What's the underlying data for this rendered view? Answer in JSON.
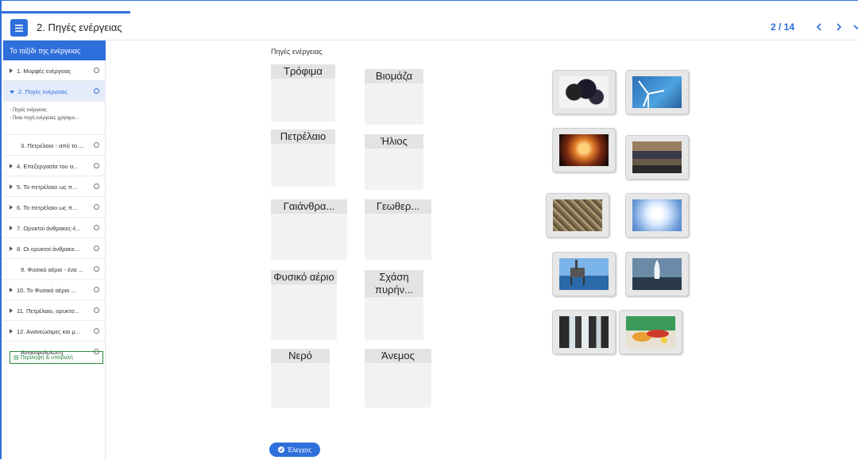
{
  "header": {
    "title": "2. Πηγές ενέργειας",
    "page_count": "2 / 14"
  },
  "icons": {
    "menu": "hamburger-icon",
    "prev": "chevron-left-icon",
    "next": "chevron-right-icon",
    "expand": "chevron-down-icon",
    "check": "check-circle-icon",
    "submit": "document-icon"
  },
  "colors": {
    "accent": "#2f6fdc",
    "submit": "#2a8a3e",
    "dropzone": "#f2f2f2"
  },
  "sidebar": {
    "heading": "Το ταξίδι της ενέργειας",
    "items": [
      {
        "label": "1. Μορφές ενέργειας"
      },
      {
        "label": "2. Πηγές ενέργειας"
      },
      {
        "label": "3. Πετρέλαιο - από το ..."
      },
      {
        "label": "4. Επεξεργασία του α..."
      },
      {
        "label": "5. Το πετρέλαιο ως π..."
      },
      {
        "label": "6. Το πετρέλαιο ως π..."
      },
      {
        "label": "7. Ορυκτοί άνθρακες-έ..."
      },
      {
        "label": "8. Οι ορυκτοί άνθρακε..."
      },
      {
        "label": "9. Φυσικό αέριο - ένα ..."
      },
      {
        "label": "10. Το Φυσικό αέριο ..."
      },
      {
        "label": "11. Πετρέλαιο, ορυκτο..."
      },
      {
        "label": "12. Ανανεώσιμες και μ..."
      },
      {
        "label": "Ανακεφαλαίωση"
      }
    ],
    "subitems": [
      "Πηγές ενέργειας",
      "Ποια πηγή ενέργειας χρησιμο..."
    ],
    "submit_label": "Περίληψη & υποβολή"
  },
  "exercise": {
    "title": "Πηγές ενέργειας",
    "dropzones": [
      "Τρόφιμα",
      "Βιομάζα",
      "Πετρέλαιο",
      "Ήλιος",
      "Γαιάνθρα...",
      "Γεωθερ...",
      "Φυσικό αέριο",
      "Σχάση πυρήν...",
      "Νερό",
      "Άνεμος"
    ],
    "check_label": "Έλεγχος"
  }
}
